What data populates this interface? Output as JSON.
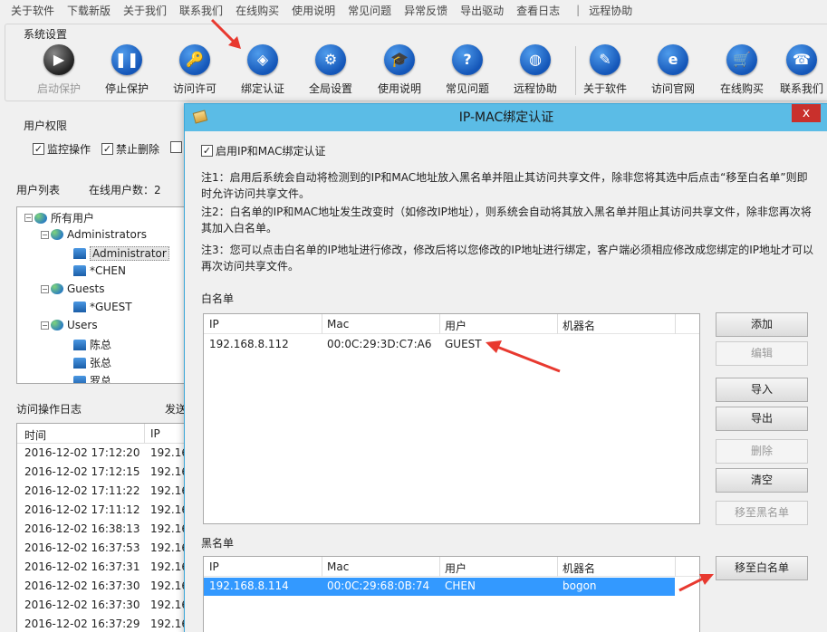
{
  "menu": [
    "关于软件",
    "下载新版",
    "关于我们",
    "联系我们",
    "在线购买",
    "使用说明",
    "常见问题",
    "异常反馈",
    "导出驱动",
    "查看日志",
    "|",
    "远程协助"
  ],
  "system_group": {
    "title": "系统设置",
    "buttons": [
      {
        "label": "启动保护",
        "glyph": "▶",
        "disabled": true
      },
      {
        "label": "停止保护",
        "glyph": "❚❚",
        "disabled": false
      },
      {
        "label": "访问许可",
        "glyph": "🔑",
        "disabled": false
      },
      {
        "label": "绑定认证",
        "glyph": "◈",
        "disabled": false
      },
      {
        "label": "全局设置",
        "glyph": "⚙",
        "disabled": false
      },
      {
        "label": "使用说明",
        "glyph": "🎓",
        "disabled": false
      },
      {
        "label": "常见问题",
        "glyph": "?",
        "disabled": false
      },
      {
        "label": "远程协助",
        "glyph": "◍",
        "disabled": false
      },
      {
        "label": "关于软件",
        "glyph": "✎",
        "disabled": false
      },
      {
        "label": "访问官网",
        "glyph": "e",
        "disabled": false
      },
      {
        "label": "在线购买",
        "glyph": "🛒",
        "disabled": false
      },
      {
        "label": "联系我们",
        "glyph": "☎",
        "disabled": false
      }
    ]
  },
  "permissions": {
    "title": "用户权限",
    "options": [
      {
        "label": "监控操作",
        "checked": true
      },
      {
        "label": "禁止删除",
        "checked": true
      }
    ]
  },
  "users": {
    "header": "用户列表",
    "online": "在线用户数：2",
    "tree": [
      {
        "label": "所有用户",
        "level": 0,
        "icon": "globe"
      },
      {
        "label": "Administrators",
        "level": 1,
        "icon": "globe"
      },
      {
        "label": "Administrator",
        "level": 2,
        "icon": "user",
        "selected": true
      },
      {
        "label": "*CHEN",
        "level": 2,
        "icon": "user"
      },
      {
        "label": "Guests",
        "level": 1,
        "icon": "globe"
      },
      {
        "label": "*GUEST",
        "level": 2,
        "icon": "user"
      },
      {
        "label": "Users",
        "level": 1,
        "icon": "globe"
      },
      {
        "label": "陈总",
        "level": 2,
        "icon": "user"
      },
      {
        "label": "张总",
        "level": 2,
        "icon": "user"
      },
      {
        "label": "罗总",
        "level": 2,
        "icon": "user"
      }
    ]
  },
  "log": {
    "header": "访问操作日志",
    "send_header": "发送",
    "columns": [
      "时间",
      "IP"
    ],
    "rows": [
      [
        "2016-12-02 17:12:20",
        "192.16"
      ],
      [
        "2016-12-02 17:12:15",
        "192.16"
      ],
      [
        "2016-12-02 17:11:22",
        "192.16"
      ],
      [
        "2016-12-02 17:11:12",
        "192.16"
      ],
      [
        "2016-12-02 16:38:13",
        "192.16"
      ],
      [
        "2016-12-02 16:37:53",
        "192.16"
      ],
      [
        "2016-12-02 16:37:31",
        "192.16"
      ],
      [
        "2016-12-02 16:37:30",
        "192.16"
      ],
      [
        "2016-12-02 16:37:30",
        "192.16"
      ],
      [
        "2016-12-02 16:37:29",
        "192.16"
      ]
    ]
  },
  "dialog": {
    "title": "IP-MAC绑定认证",
    "close": "x",
    "enable_label": "启用IP和MAC绑定认证",
    "enable_checked": true,
    "notes": [
      "注1：启用后系统会自动将检测到的IP和MAC地址放入黑名单并阻止其访问共享文件，除非您将其选中后点击“移至白名单”则即时允许访问共享文件。",
      "注2：白名单的IP和MAC地址发生改变时（如修改IP地址），则系统会自动将其放入黑名单并阻止其访问共享文件，除非您再次将其加入白名单。",
      "注3：您可以点击白名单的IP地址进行修改，修改后将以您修改的IP地址进行绑定，客户端必须相应修改成您绑定的IP地址才可以再次访问共享文件。"
    ],
    "whitelist": {
      "label": "白名单",
      "columns": [
        "IP",
        "Mac",
        "用户",
        "机器名"
      ],
      "rows": [
        [
          "192.168.8.112",
          "00:0C:29:3D:C7:A6",
          "GUEST",
          ""
        ]
      ]
    },
    "blacklist": {
      "label": "黑名单",
      "columns": [
        "IP",
        "Mac",
        "用户",
        "机器名"
      ],
      "rows": [
        [
          "192.168.8.114",
          "00:0C:29:68:0B:74",
          "CHEN",
          "bogon"
        ]
      ]
    },
    "buttons": {
      "add": "添加",
      "edit": "编辑",
      "import": "导入",
      "export": "导出",
      "delete": "删除",
      "clear": "清空",
      "to_black": "移至黑名单",
      "to_white": "移至白名单"
    }
  },
  "colors": {
    "title_bar": "#5bbce6",
    "selection": "#3399ff",
    "arrow": "#e8392f"
  }
}
